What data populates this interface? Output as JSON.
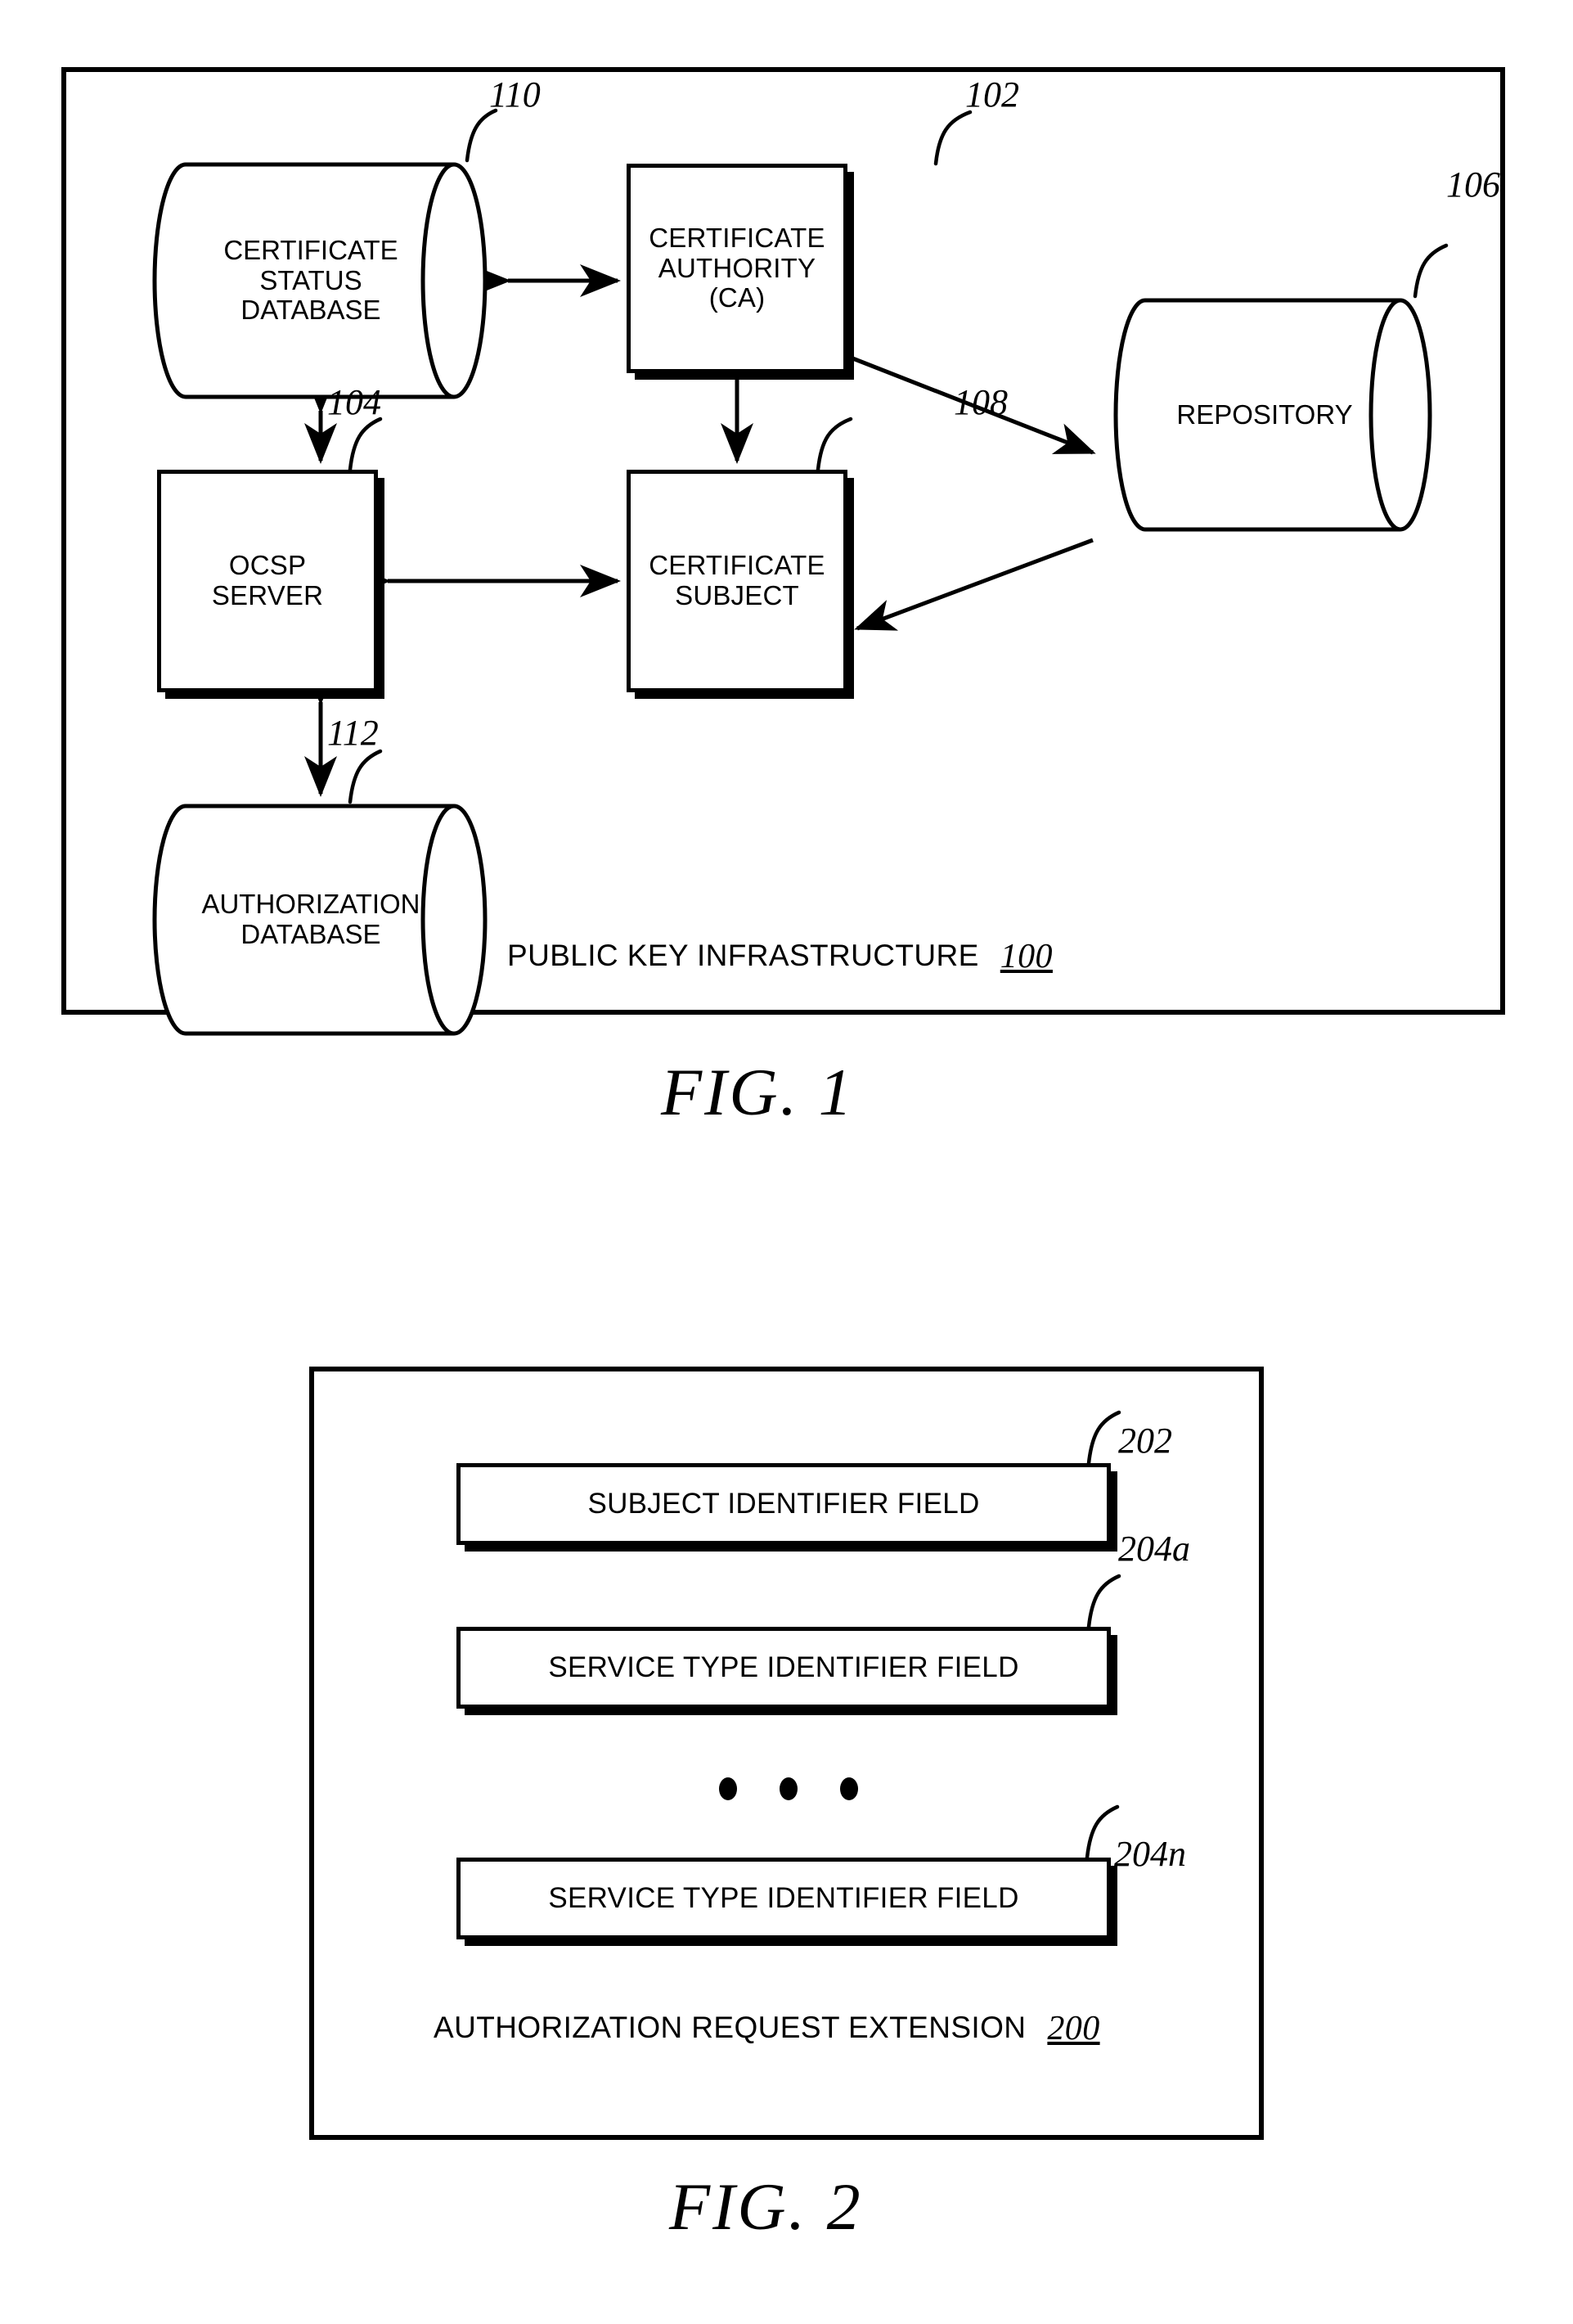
{
  "figure1": {
    "frame_caption": "PUBLIC KEY INFRASTRUCTURE",
    "frame_caption_ref": "100",
    "title": "FIG. 1",
    "nodes": [
      {
        "id": "certificate-status-database",
        "label": "CERTIFICATE\nSTATUS\nDATABASE",
        "ref": "110",
        "shape": "cylinder"
      },
      {
        "id": "certificate-authority",
        "label": "CERTIFICATE\nAUTHORITY\n(CA)",
        "ref": "102",
        "shape": "rect"
      },
      {
        "id": "repository",
        "label": "REPOSITORY",
        "ref": "106",
        "shape": "cylinder"
      },
      {
        "id": "ocsp-server",
        "label": "OCSP\nSERVER",
        "ref": "104",
        "shape": "rect"
      },
      {
        "id": "certificate-subject",
        "label": "CERTIFICATE\nSUBJECT",
        "ref": "108",
        "shape": "rect"
      },
      {
        "id": "authorization-database",
        "label": "AUTHORIZATION\nDATABASE",
        "ref": "112",
        "shape": "cylinder"
      }
    ],
    "connections": [
      {
        "from": "certificate-status-database",
        "to": "certificate-authority",
        "arrow": "bidirectional"
      },
      {
        "from": "certificate-status-database",
        "to": "ocsp-server",
        "arrow": "bidirectional"
      },
      {
        "from": "certificate-authority",
        "to": "repository",
        "arrow": "unidirectional"
      },
      {
        "from": "certificate-authority",
        "to": "certificate-subject",
        "arrow": "unidirectional"
      },
      {
        "from": "repository",
        "to": "certificate-subject",
        "arrow": "unidirectional"
      },
      {
        "from": "ocsp-server",
        "to": "certificate-subject",
        "arrow": "bidirectional"
      },
      {
        "from": "ocsp-server",
        "to": "authorization-database",
        "arrow": "bidirectional"
      }
    ]
  },
  "figure2": {
    "frame_caption": "AUTHORIZATION REQUEST EXTENSION",
    "frame_caption_ref": "200",
    "title": "FIG. 2",
    "fields": [
      {
        "id": "subject-identifier-field",
        "label": "SUBJECT IDENTIFIER FIELD",
        "ref": "202"
      },
      {
        "id": "service-type-identifier-a",
        "label": "SERVICE TYPE IDENTIFIER FIELD",
        "ref": "204a"
      },
      {
        "id": "service-type-identifier-n",
        "label": "SERVICE TYPE IDENTIFIER FIELD",
        "ref": "204n"
      }
    ],
    "ellipsis": "• • •"
  },
  "colors": {
    "stroke": "#000000",
    "background": "#ffffff"
  }
}
